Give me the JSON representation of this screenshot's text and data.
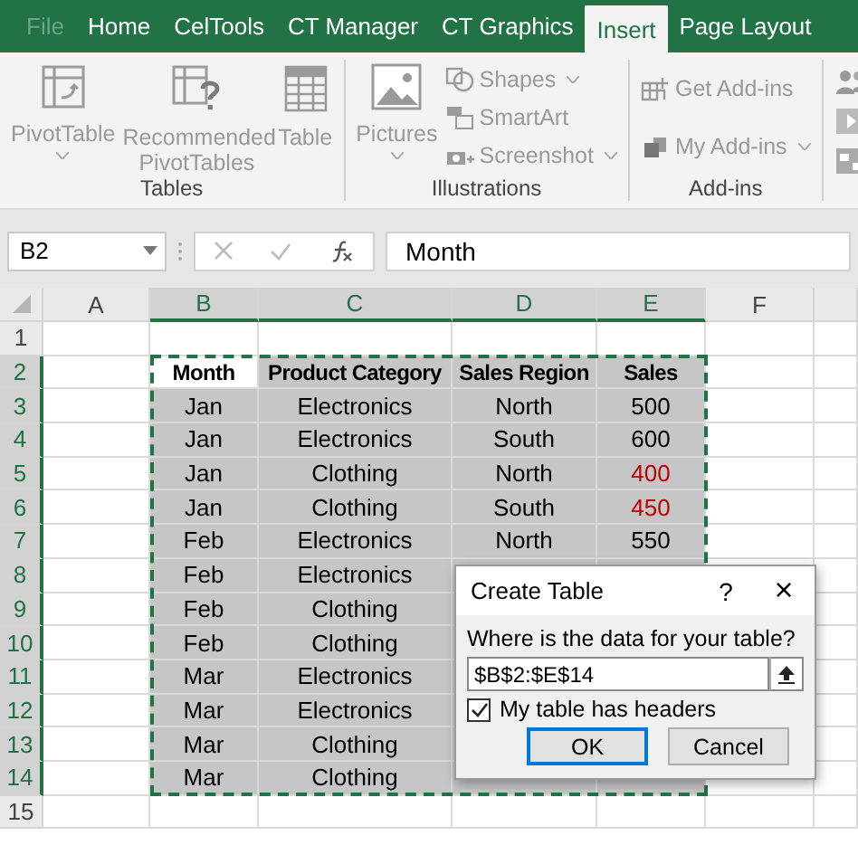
{
  "tabs": [
    {
      "label": "File",
      "selected": false
    },
    {
      "label": "Home",
      "selected": false
    },
    {
      "label": "CelTools",
      "selected": false
    },
    {
      "label": "CT Manager",
      "selected": false
    },
    {
      "label": "CT Graphics",
      "selected": false
    },
    {
      "label": "Insert",
      "selected": true
    },
    {
      "label": "Page Layout",
      "selected": false
    }
  ],
  "ribbon": {
    "groups": [
      {
        "label": "Tables",
        "items": [
          {
            "kind": "large",
            "label": "PivotTable",
            "dropdown": true
          },
          {
            "kind": "large",
            "label": "Recommended PivotTables",
            "dropdown": false
          },
          {
            "kind": "large",
            "label": "Table",
            "dropdown": false
          }
        ]
      },
      {
        "label": "Illustrations",
        "items": [
          {
            "kind": "large",
            "label": "Pictures",
            "dropdown": true
          },
          {
            "kind": "small",
            "label": "Shapes",
            "dropdown": true
          },
          {
            "kind": "small",
            "label": "SmartArt",
            "dropdown": false
          },
          {
            "kind": "small",
            "label": "Screenshot",
            "dropdown": true
          }
        ]
      },
      {
        "label": "Add-ins",
        "items": [
          {
            "kind": "small",
            "label": "Get Add-ins",
            "dropdown": false
          },
          {
            "kind": "small",
            "label": "My Add-ins",
            "dropdown": true
          }
        ]
      },
      {
        "items": [
          {
            "kind": "icon"
          },
          {
            "kind": "icon"
          },
          {
            "kind": "icon"
          }
        ]
      }
    ]
  },
  "formula_bar": {
    "name_box": "B2",
    "formula": "Month"
  },
  "sheet": {
    "columns": [
      "A",
      "B",
      "C",
      "D",
      "E",
      "F"
    ],
    "rows": [
      {
        "number": "1",
        "cells": []
      },
      {
        "number": "2",
        "cells": [
          "",
          "Month",
          "Product Category",
          "Sales Region",
          "Sales"
        ],
        "header": true
      },
      {
        "number": "3",
        "cells": [
          "",
          "Jan",
          "Electronics",
          "North",
          {
            "text": "500",
            "color": "#000000"
          }
        ]
      },
      {
        "number": "4",
        "cells": [
          "",
          "Jan",
          "Electronics",
          "South",
          {
            "text": "600",
            "color": "#000000"
          }
        ]
      },
      {
        "number": "5",
        "cells": [
          "",
          "Jan",
          "Clothing",
          "North",
          {
            "text": "400",
            "color": "#c00000"
          }
        ]
      },
      {
        "number": "6",
        "cells": [
          "",
          "Jan",
          "Clothing",
          "South",
          {
            "text": "450",
            "color": "#c00000"
          }
        ]
      },
      {
        "number": "7",
        "cells": [
          "",
          "Feb",
          "Electronics",
          "North",
          {
            "text": "550",
            "color": "#000000"
          }
        ]
      },
      {
        "number": "8",
        "cells": [
          "",
          "Feb",
          "Electronics"
        ]
      },
      {
        "number": "9",
        "cells": [
          "",
          "Feb",
          "Clothing"
        ]
      },
      {
        "number": "10",
        "cells": [
          "",
          "Feb",
          "Clothing"
        ]
      },
      {
        "number": "11",
        "cells": [
          "",
          "Mar",
          "Electronics"
        ]
      },
      {
        "number": "12",
        "cells": [
          "",
          "Mar",
          "Electronics"
        ]
      },
      {
        "number": "13",
        "cells": [
          "",
          "Mar",
          "Clothing"
        ]
      },
      {
        "number": "14",
        "cells": [
          "",
          "Mar",
          "Clothing"
        ]
      },
      {
        "number": "15",
        "cells": []
      }
    ]
  },
  "dialog": {
    "title": "Create Table",
    "help": "?",
    "close": "×",
    "prompt": "Where is the data for your table?",
    "range": "$B$2:$E$14",
    "headers_label": "My table has headers",
    "headers_checked": true,
    "buttons": [
      {
        "label": "OK",
        "selected": true
      },
      {
        "label": "Cancel",
        "selected": false
      }
    ]
  }
}
